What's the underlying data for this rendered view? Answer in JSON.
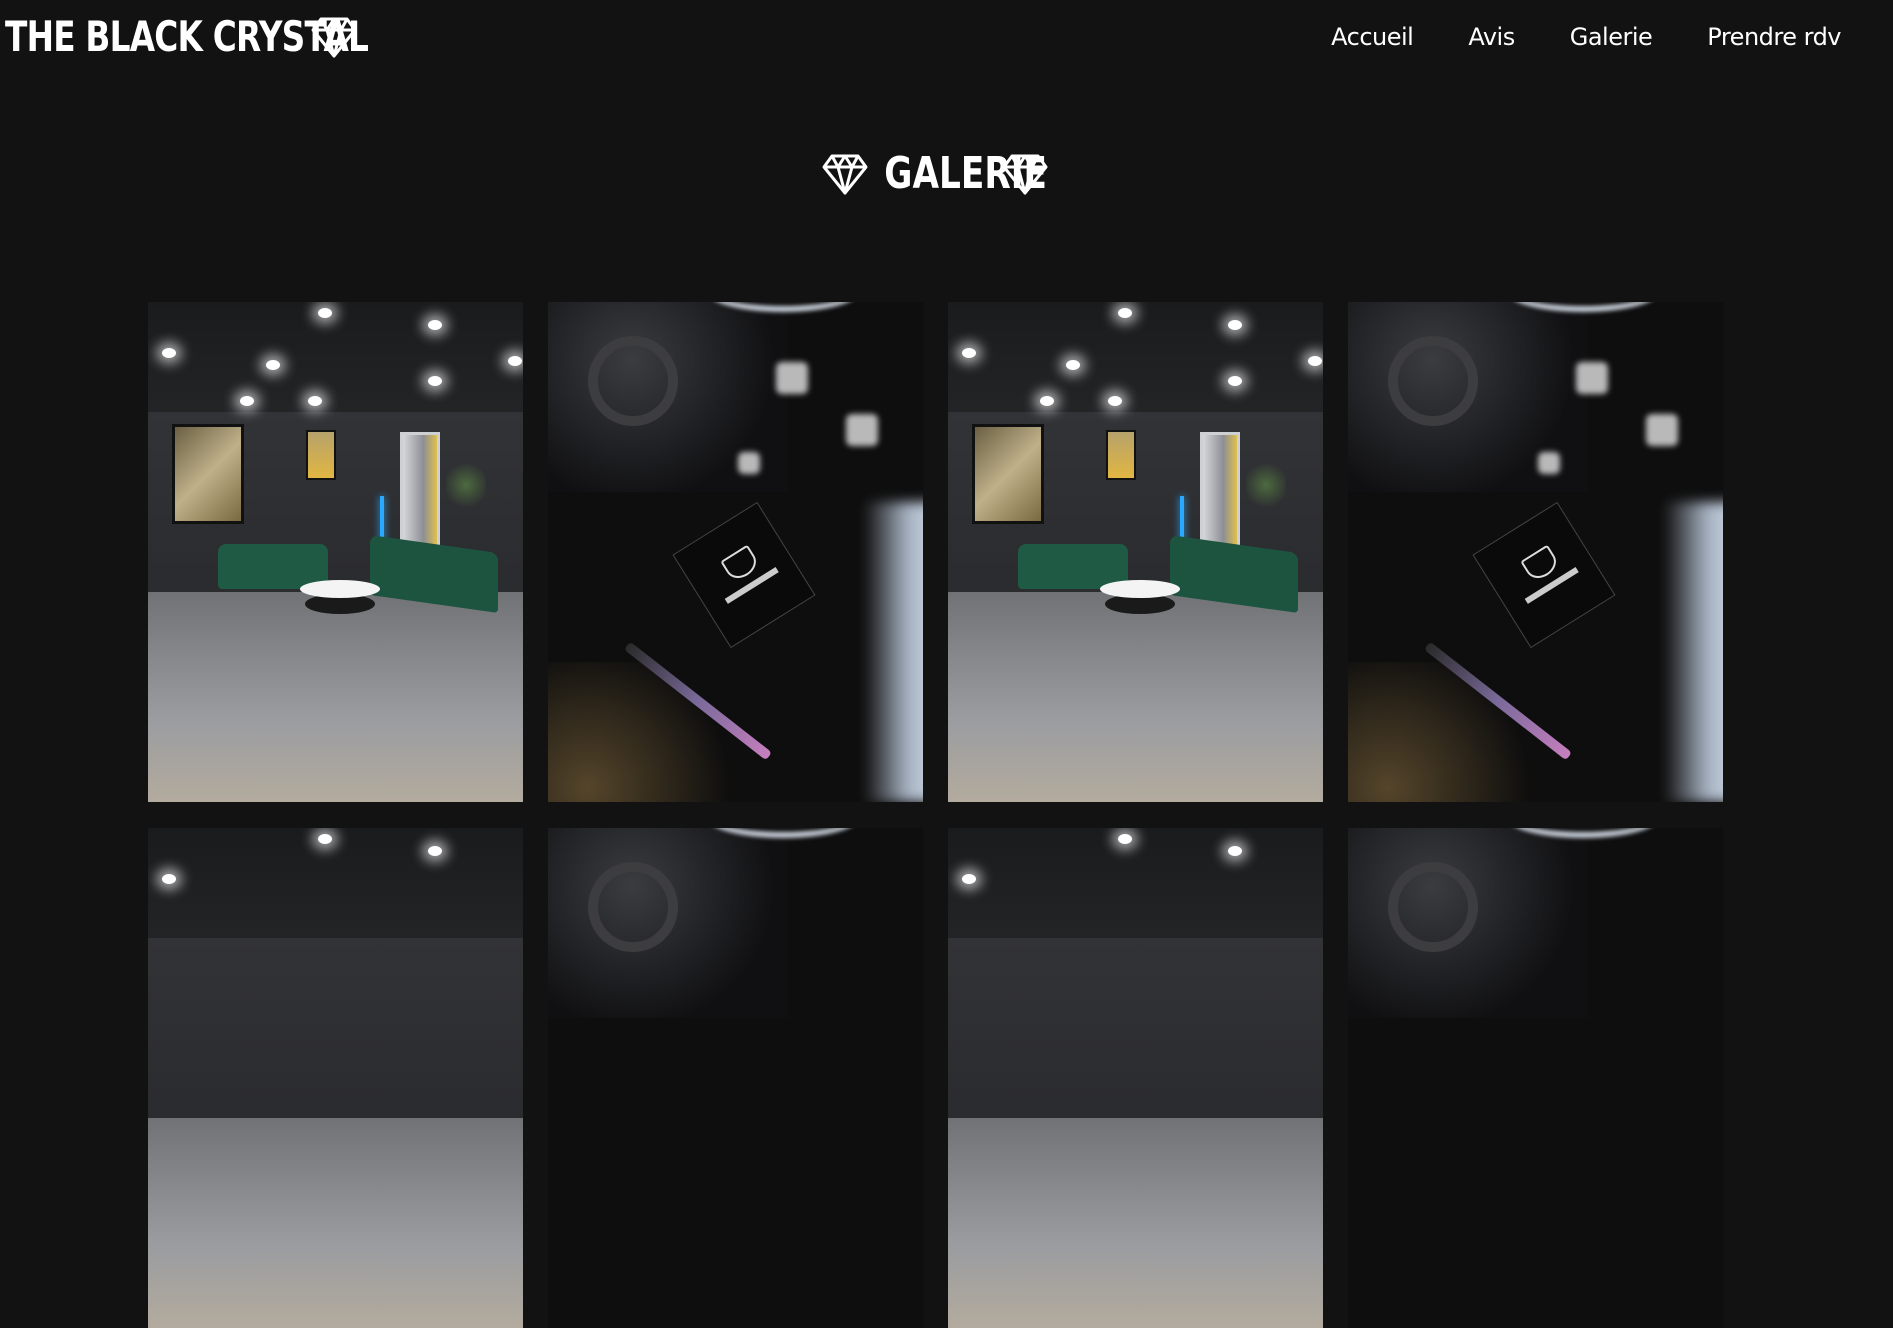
{
  "brand": {
    "name": "THE BLACK CRYSTAL",
    "icon": "diamond-icon"
  },
  "nav": {
    "items": [
      {
        "label": "Accueil"
      },
      {
        "label": "Avis"
      },
      {
        "label": "Galerie"
      },
      {
        "label": "Prendre rdv"
      }
    ]
  },
  "section": {
    "title": "GALERIE",
    "icon": "diamond-icon"
  },
  "gallery": {
    "images": [
      {
        "subject": "lounge-photo"
      },
      {
        "subject": "closeup-photo"
      },
      {
        "subject": "lounge-photo"
      },
      {
        "subject": "closeup-photo"
      },
      {
        "subject": "lounge-photo"
      },
      {
        "subject": "closeup-photo"
      },
      {
        "subject": "lounge-photo"
      },
      {
        "subject": "closeup-photo"
      }
    ]
  },
  "colors": {
    "background": "#121212",
    "text": "#ffffff"
  }
}
